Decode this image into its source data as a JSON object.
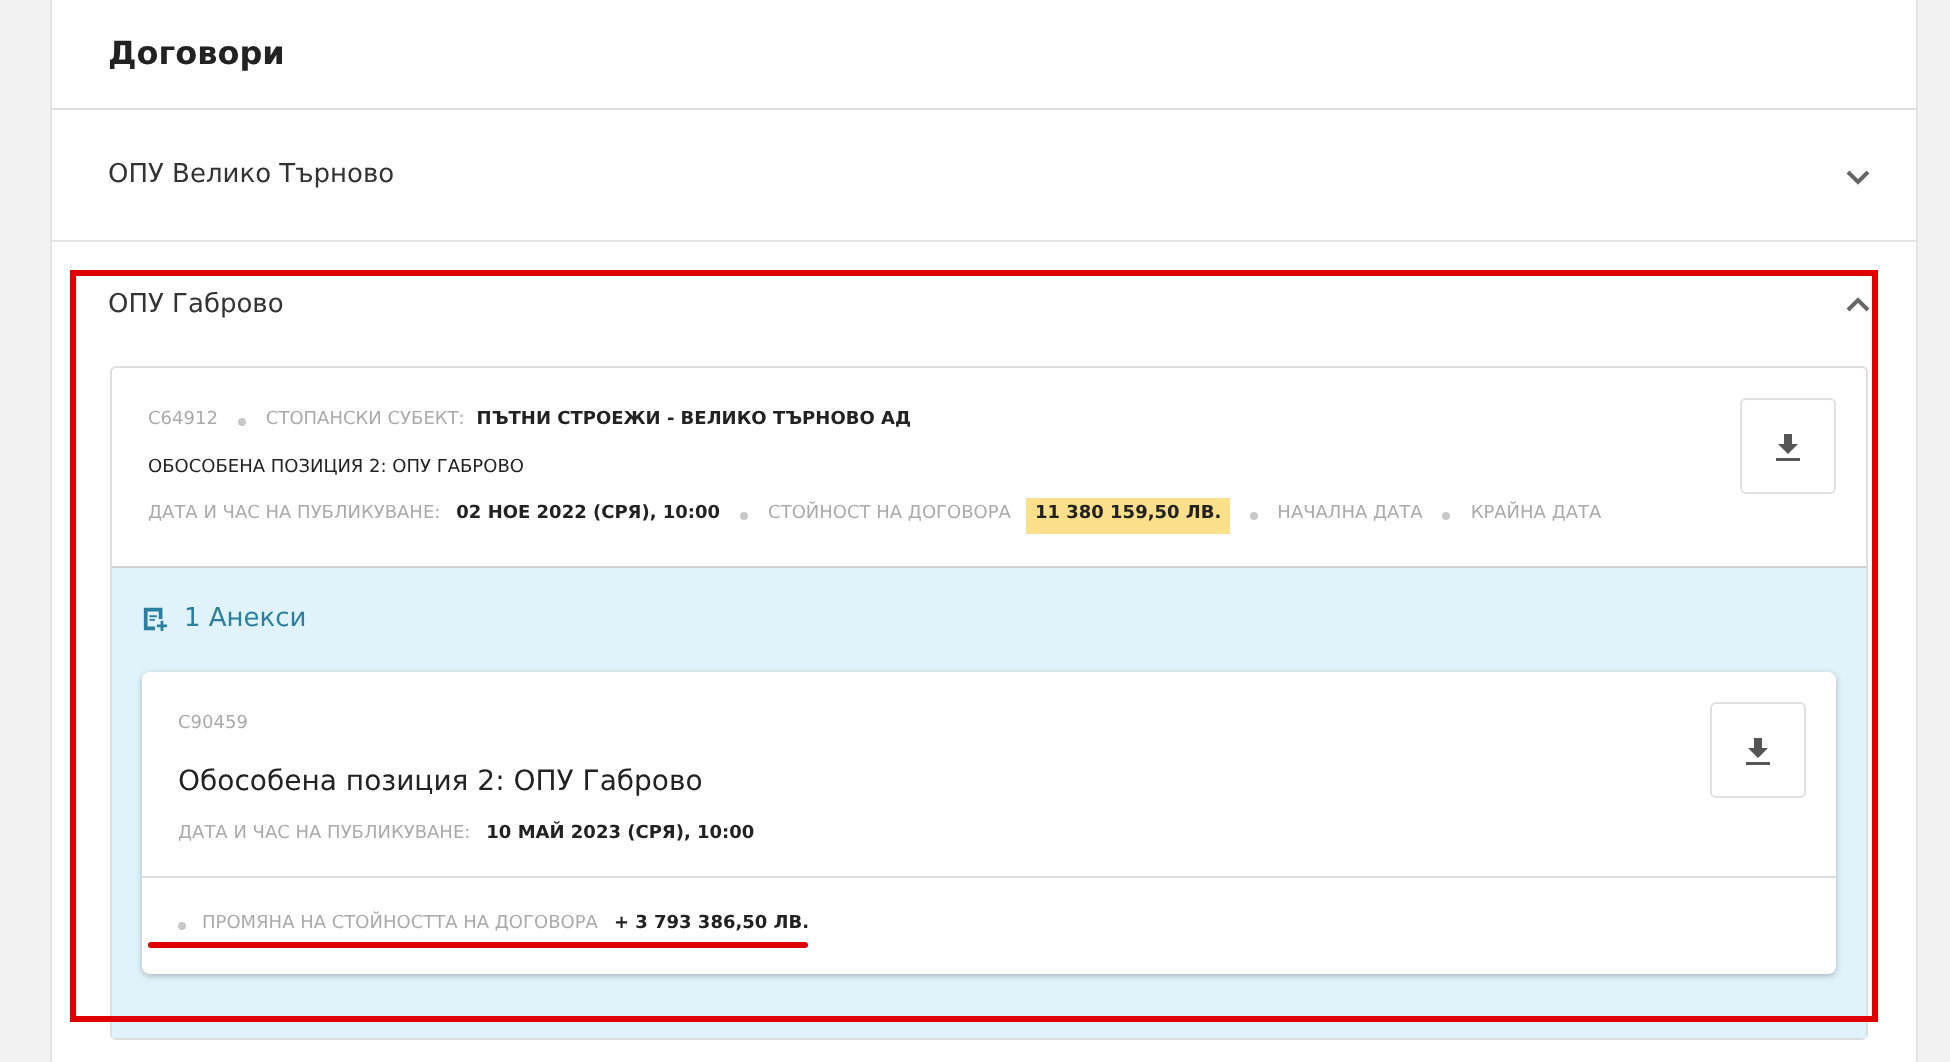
{
  "title": "Договори",
  "sections": [
    {
      "title": "ОПУ Велико Търново",
      "expanded": false
    },
    {
      "title": "ОПУ Габрово",
      "expanded": true,
      "contract": {
        "number": "C64912",
        "subject_label": "СТОПАНСКИ СУБЕКТ:",
        "subject": "ПЪТНИ СТРОЕЖИ - ВЕЛИКО ТЪРНОВО АД",
        "position": "ОБОСОБЕНА ПОЗИЦИЯ 2: ОПУ ГАБРОВО",
        "published_label": "ДАТА И ЧАС НА ПУБЛИКУВАНЕ:",
        "published": "02 НОЕ 2022 (СРЯ), 10:00",
        "value_label": "СТОЙНОСТ НА ДОГОВОРА",
        "value": "11 380 159,50 ЛВ.",
        "start_label": "НАЧАЛНА ДАТА",
        "end_label": "КРАЙНА ДАТА",
        "annexes_label": "1 Анекси",
        "annexes": [
          {
            "number": "C90459",
            "title": "Обособена позиция 2: ОПУ Габрово",
            "published_label": "ДАТА И ЧАС НА ПУБЛИКУВАНЕ:",
            "published": "10 МАЙ 2023 (СРЯ), 10:00",
            "change_label": "ПРОМЯНА НА СТОЙНОСТТА НА ДОГОВОРА",
            "change": "+ 3 793 386,50 ЛВ."
          }
        ]
      }
    }
  ]
}
